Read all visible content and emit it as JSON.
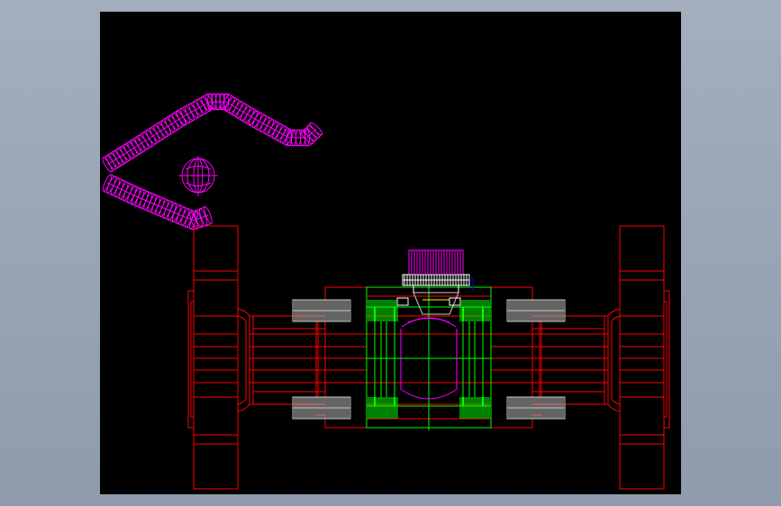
{
  "app": {
    "background": "#99a5b6",
    "viewport_background": "#000000"
  },
  "colors": {
    "flange": "#ff0000",
    "body": "#ff0000",
    "bolts": "#c8c8c8",
    "seat": "#00ff00",
    "handle": "#ff00ff",
    "stem_ring": "#ffffff",
    "stem_highlight": "#0000ff",
    "ball": "#ff00ff"
  },
  "drawing": {
    "subject": "ball-valve-cad-drawing",
    "handle_icon": "lever-handle-icon",
    "stem_icon": "stem-icon"
  }
}
